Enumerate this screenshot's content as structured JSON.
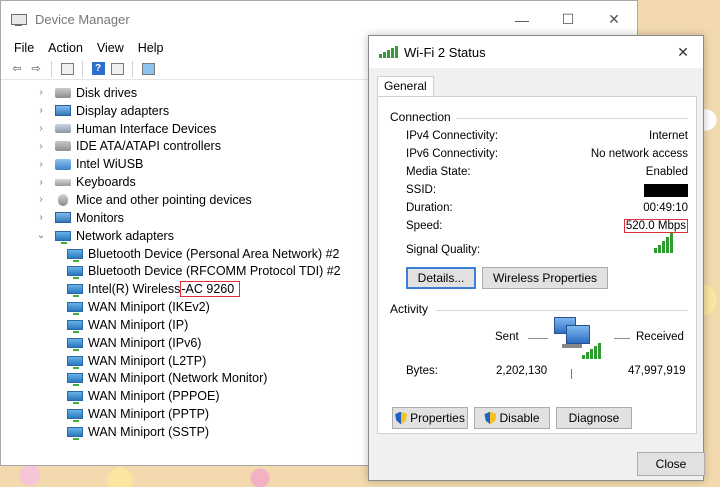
{
  "device_manager": {
    "title": "Device Manager",
    "window_controls": {
      "minimize": "—",
      "maximize": "☐",
      "close": "✕"
    },
    "menu": [
      "File",
      "Action",
      "View",
      "Help"
    ],
    "tree": [
      {
        "label": "Disk drives",
        "icon": "disk-icon",
        "level": 0,
        "expander": "›"
      },
      {
        "label": "Display adapters",
        "icon": "display-adapter-icon",
        "level": 0,
        "expander": "›"
      },
      {
        "label": "Human Interface Devices",
        "icon": "hid-icon",
        "level": 0,
        "expander": "›"
      },
      {
        "label": "IDE ATA/ATAPI controllers",
        "icon": "ide-controller-icon",
        "level": 0,
        "expander": "›"
      },
      {
        "label": "Intel WiUSB",
        "icon": "usb-device-icon",
        "level": 0,
        "expander": "›"
      },
      {
        "label": "Keyboards",
        "icon": "keyboard-icon",
        "level": 0,
        "expander": "›"
      },
      {
        "label": "Mice and other pointing devices",
        "icon": "mouse-icon",
        "level": 0,
        "expander": "›"
      },
      {
        "label": "Monitors",
        "icon": "monitor-icon",
        "level": 0,
        "expander": "›"
      },
      {
        "label": "Network adapters",
        "icon": "network-adapter-icon",
        "level": 0,
        "expander": "⌄"
      },
      {
        "label": "Bluetooth Device (Personal Area Network) #2",
        "icon": "network-adapter-icon",
        "level": 1
      },
      {
        "label": "Bluetooth Device (RFCOMM Protocol TDI) #2",
        "icon": "network-adapter-icon",
        "level": 1
      },
      {
        "label": "Intel(R) Wireless",
        "label_highlighted": "-AC 9260",
        "icon": "network-adapter-icon",
        "level": 1
      },
      {
        "label": "WAN Miniport (IKEv2)",
        "icon": "network-adapter-icon",
        "level": 1
      },
      {
        "label": "WAN Miniport (IP)",
        "icon": "network-adapter-icon",
        "level": 1
      },
      {
        "label": "WAN Miniport (IPv6)",
        "icon": "network-adapter-icon",
        "level": 1
      },
      {
        "label": "WAN Miniport (L2TP)",
        "icon": "network-adapter-icon",
        "level": 1
      },
      {
        "label": "WAN Miniport (Network Monitor)",
        "icon": "network-adapter-icon",
        "level": 1
      },
      {
        "label": "WAN Miniport (PPPOE)",
        "icon": "network-adapter-icon",
        "level": 1
      },
      {
        "label": "WAN Miniport (PPTP)",
        "icon": "network-adapter-icon",
        "level": 1
      },
      {
        "label": "WAN Miniport (SSTP)",
        "icon": "network-adapter-icon",
        "level": 1
      }
    ]
  },
  "wifi_status": {
    "title": "Wi-Fi 2 Status",
    "close": "✕",
    "tab": "General",
    "connection": {
      "heading": "Connection",
      "rows": [
        {
          "key": "IPv4 Connectivity:",
          "value": "Internet"
        },
        {
          "key": "IPv6 Connectivity:",
          "value": "No network access"
        },
        {
          "key": "Media State:",
          "value": "Enabled"
        },
        {
          "key": "SSID:",
          "value": ""
        },
        {
          "key": "Duration:",
          "value": "00:49:10"
        },
        {
          "key": "Speed:",
          "value": "520.0 Mbps"
        }
      ],
      "signal_label": "Signal Quality:",
      "signal_bars": 5
    },
    "buttons": {
      "details": "Details...",
      "wireless_properties": "Wireless Properties",
      "properties": "Properties",
      "disable": "Disable",
      "diagnose": "Diagnose",
      "close": "Close"
    },
    "activity": {
      "heading": "Activity",
      "sent_label": "Sent",
      "received_label": "Received",
      "bytes_label": "Bytes:",
      "sent_bytes": "2,202,130",
      "received_bytes": "47,997,919"
    }
  }
}
